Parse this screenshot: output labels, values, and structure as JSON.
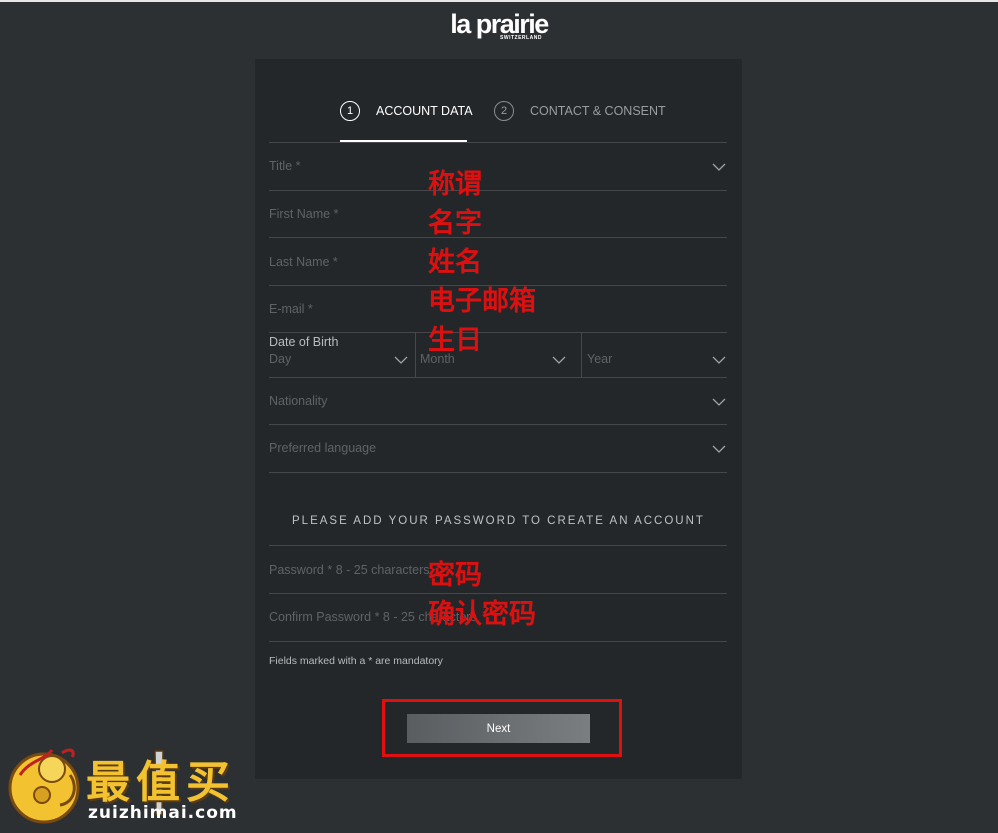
{
  "brand": {
    "name": "la prairie",
    "subtitle": "SWITZERLAND"
  },
  "steps": [
    {
      "number": "1",
      "label": "ACCOUNT DATA",
      "active": true
    },
    {
      "number": "2",
      "label": "CONTACT & CONSENT",
      "active": false
    }
  ],
  "fields": {
    "title": "Title *",
    "first_name": "First Name *",
    "last_name": "Last Name *",
    "email": "E-mail *",
    "dob_label": "Date of Birth",
    "day": "Day",
    "month": "Month",
    "year": "Year",
    "nationality": "Nationality",
    "preferred_language": "Preferred language",
    "password": "Password * 8 - 25 characters",
    "confirm_password": "Confirm Password * 8 - 25 characters"
  },
  "password_heading": "PLEASE ADD YOUR PASSWORD TO CREATE AN ACCOUNT",
  "mandatory_note": "Fields marked with a * are mandatory",
  "next_label": "Next",
  "annotations": {
    "title": "称谓",
    "first_name": "名字",
    "last_name": "姓名",
    "email": "电子邮箱",
    "dob": "生日",
    "password": "密码",
    "confirm_password": "确认密码"
  },
  "watermark": {
    "title": "最值买",
    "url": "zuizhimai.com"
  },
  "colors": {
    "background": "#2d3033",
    "panel": "#24272a",
    "annotation": "#dc1010",
    "highlight_box": "#e01010"
  }
}
